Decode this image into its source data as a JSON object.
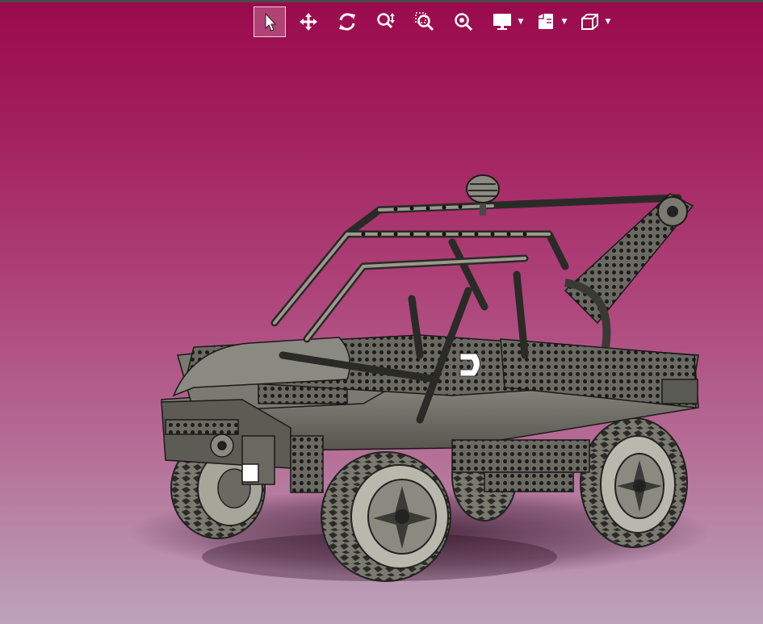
{
  "viewer": {
    "background_top": "#9a0a4c",
    "background_bottom": "#bca3bb",
    "model_color": "#6e6e66"
  },
  "toolbar": {
    "tools": [
      {
        "name": "select-tool",
        "icon": "arrow-pointer-icon",
        "active": true
      },
      {
        "name": "pan-tool",
        "icon": "move-arrows-icon",
        "active": false
      },
      {
        "name": "rotate-tool",
        "icon": "rotate-icon",
        "active": false
      },
      {
        "name": "zoom-tool",
        "icon": "zoom-updown-icon",
        "active": false
      },
      {
        "name": "zoom-window-tool",
        "icon": "zoom-window-icon",
        "active": false
      },
      {
        "name": "zoom-fit-tool",
        "icon": "zoom-fit-icon",
        "active": false
      },
      {
        "name": "display-mode-tool",
        "icon": "monitor-icon",
        "active": false,
        "dropdown": true
      },
      {
        "name": "view-orientation-tool",
        "icon": "views-icon",
        "active": false,
        "dropdown": true
      },
      {
        "name": "standard-views-tool",
        "icon": "cube-icon",
        "active": false,
        "dropdown": true
      }
    ]
  },
  "model": {
    "description_icon": "lego-technic-tow-truck-model"
  }
}
